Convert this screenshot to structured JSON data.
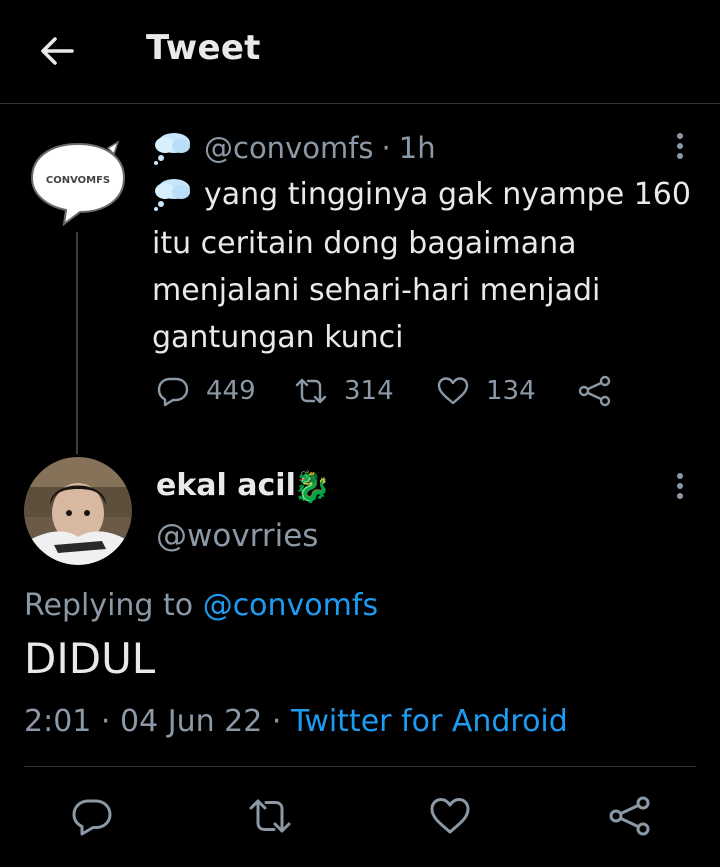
{
  "header": {
    "title": "Tweet",
    "back_icon": "arrow-left-icon"
  },
  "parent_tweet": {
    "handle": "@convomfs",
    "separator": "·",
    "time": "1h",
    "avatar_logo_text": "CONVOMFS",
    "text_first_line": "yang tingginya gak nyampe 160",
    "text_rest": "itu ceritain dong bagaimana\nmenjalani sehari-hari menjadi\ngantungan kunci",
    "emoji_icon": "cloud-icon",
    "stats": {
      "replies": "449",
      "retweets": "314",
      "likes": "134"
    }
  },
  "reply_tweet": {
    "name": "ekal acil",
    "name_emoji": "🐉",
    "handle": "@wovrries",
    "replying_label": "Replying to",
    "replying_handle": "@convomfs",
    "text": "DIDUL",
    "time": "2:01",
    "separator": "·",
    "date": "04 Jun 22",
    "source": "Twitter for Android"
  },
  "colors": {
    "background": "#000000",
    "text": "#e7e9ea",
    "muted": "#8b98a5",
    "link": "#1d9bf0",
    "divider": "#2f3336"
  }
}
